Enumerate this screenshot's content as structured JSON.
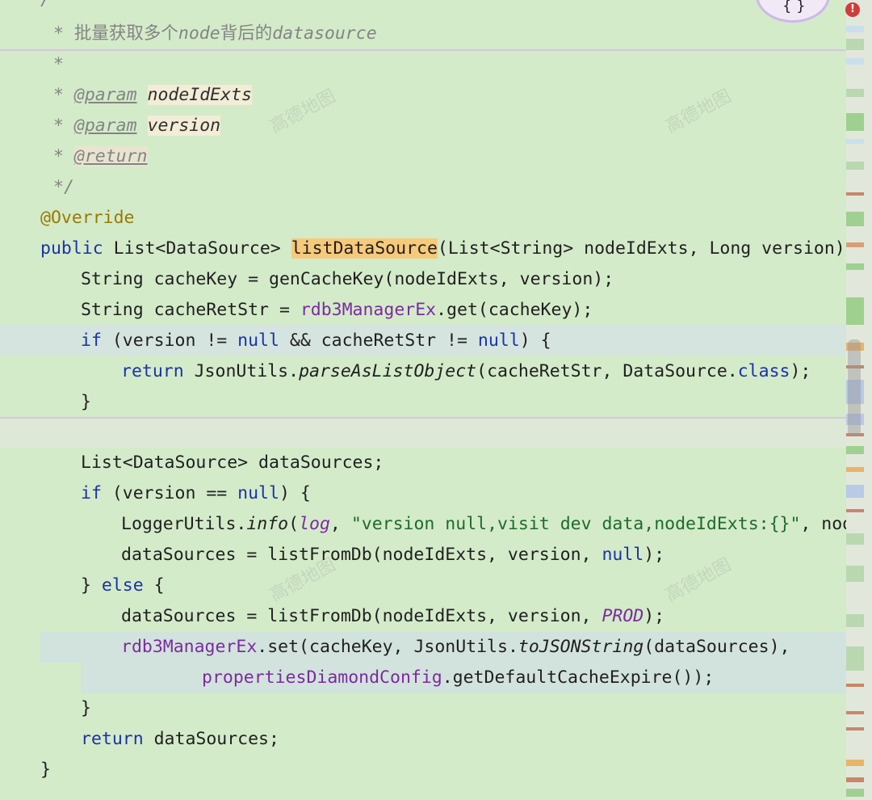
{
  "editor": {
    "doc_comment": {
      "open": "/**",
      "summary_prefix": "* ",
      "summary_cn1": "批量获取多个",
      "summary_node": "node",
      "summary_cn2": "背后的",
      "summary_ds": "datasource",
      "blank": "*",
      "param_tag": "@param",
      "param1": "nodeIdExts",
      "param2": "version",
      "return_tag": "@return",
      "close": "*/"
    },
    "annotation": "@Override",
    "signature": {
      "public": "public",
      "return_type": "List<DataSource>",
      "method": "listDataSource",
      "params": "(List<String> nodeIdExts, Long version) {"
    },
    "body": {
      "l1": "String cacheKey = genCacheKey(nodeIdExts, version);",
      "l2a": "String cacheRetStr = ",
      "l2b": "rdb3ManagerEx",
      "l2c": ".get(cacheKey);",
      "if1_kw": "if",
      "if1_a": " (version != ",
      "null": "null",
      "if1_b": " && cacheRetStr != ",
      "if1_c": ") {",
      "return": "return",
      "ret1_a": " JsonUtils.",
      "ret1_m": "parseAsListObject",
      "ret1_b": "(cacheRetStr, DataSource.",
      "class": "class",
      "ret1_c": ");",
      "close": "}",
      "decl": "List<DataSource> dataSources;",
      "if2_a": " (version == ",
      "if2_b": ") {",
      "log_a": "LoggerUtils.",
      "log_m": "info",
      "log_b": "(",
      "log_f": "log",
      "log_c": ", ",
      "log_s": "\"version null,visit dev data,nodeIdExts:{}\"",
      "log_d": ", nod",
      "ds1_a": "dataSources = listFromDb(nodeIdExts, version, ",
      "ds1_b": ");",
      "else_a": "} ",
      "else_kw": "else",
      "else_b": " {",
      "ds2_a": "dataSources = listFromDb(nodeIdExts, version, ",
      "ds2_prod": "PROD",
      "ds2_b": ");",
      "set_f": "rdb3ManagerEx",
      "set_a": ".set(cacheKey, JsonUtils.",
      "set_m": "toJSONString",
      "set_b": "(dataSources),",
      "cfg_f": "propertiesDiamondConfig",
      "cfg_a": ".getDefaultCacheExpire());",
      "ret2": " dataSources;",
      "final": "}"
    },
    "watermark": "高德地图"
  },
  "colors": {
    "background": "#d3ebc9",
    "keyword": "#1b32a8",
    "field": "#7d2aa0",
    "string": "#1f6b2a",
    "annotation": "#9a7a00",
    "comment": "#848484",
    "method_highlight": "#f7c97a",
    "error_badge": "#d23b3b"
  },
  "gutter": {
    "error_icon": "error-icon",
    "error_glyph": "!"
  },
  "assistant_icon": {
    "name": "ai-assistant-icon",
    "glyph": "{ }"
  }
}
